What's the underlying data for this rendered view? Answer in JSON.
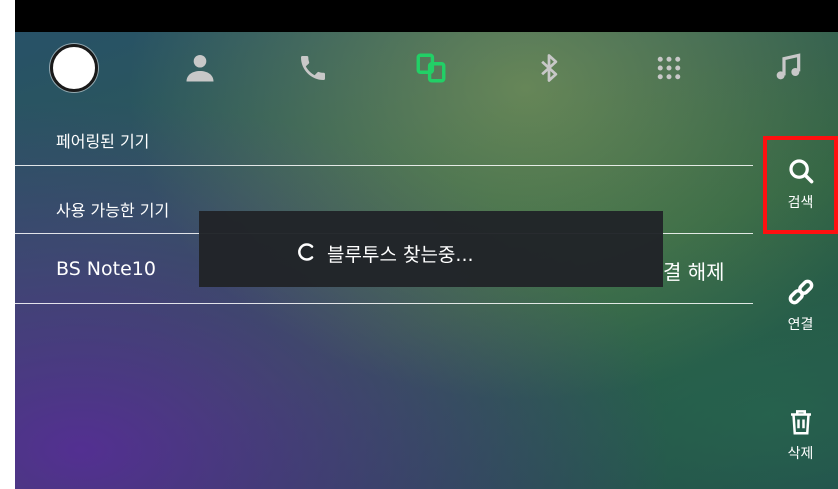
{
  "sections": {
    "paired_label": "페어링된 기기",
    "available_label": "사용 가능한 기기"
  },
  "devices": [
    {
      "name": "BS Note10",
      "action_label": "결 해제"
    }
  ],
  "toast": {
    "message": "블루투스 찾는중..."
  },
  "side_actions": {
    "search_label": "검색",
    "connect_label": "연결",
    "delete_label": "삭제"
  },
  "topbar": {
    "icons": [
      "home-icon",
      "contacts-icon",
      "phone-icon",
      "phone-link-icon",
      "bluetooth-icon",
      "apps-icon",
      "music-icon"
    ],
    "active_icon": "phone-link-icon",
    "active_color": "#22d066"
  },
  "highlight_color": "#ff1010"
}
